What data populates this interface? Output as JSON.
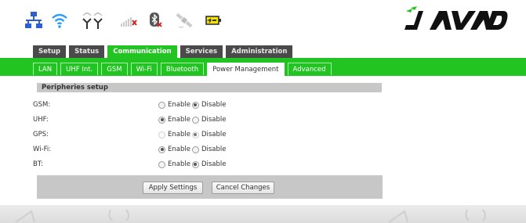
{
  "header": {
    "status_icons": [
      "lan-icon",
      "wifi-icon",
      "uhf-antennas-icon",
      "signal-bars-icon",
      "bluetooth-icon",
      "satellite-icon",
      "battery-icon"
    ],
    "logo_text": "JAVAD",
    "colors": {
      "accent_green": "#22c422",
      "dark_tab": "#4a4a4a",
      "battery_yellow": "#f5e400",
      "alert_red": "#d42020"
    }
  },
  "main_tabs": [
    {
      "label": "Setup",
      "active": false
    },
    {
      "label": "Status",
      "active": false
    },
    {
      "label": "Communication",
      "active": true
    },
    {
      "label": "Services",
      "active": false
    },
    {
      "label": "Administration",
      "active": false
    }
  ],
  "sub_tabs": [
    {
      "label": "LAN",
      "active": false
    },
    {
      "label": "UHF Int.",
      "active": false
    },
    {
      "label": "GSM",
      "active": false
    },
    {
      "label": "Wi-Fi",
      "active": false
    },
    {
      "label": "Bluetooth",
      "active": false
    },
    {
      "label": "Power Management",
      "active": true
    },
    {
      "label": "Advanced",
      "active": false
    }
  ],
  "section": {
    "title": "Peripheries setup",
    "enable_label": "Enable",
    "disable_label": "Disable",
    "rows": [
      {
        "label": "GSM:",
        "value": "Disable",
        "disabled": false
      },
      {
        "label": "UHF:",
        "value": "Enable",
        "disabled": false
      },
      {
        "label": "GPS:",
        "value": "Disable",
        "disabled": true
      },
      {
        "label": "Wi-Fi:",
        "value": "Enable",
        "disabled": false
      },
      {
        "label": "BT:",
        "value": "Disable",
        "disabled": false
      }
    ]
  },
  "actions": {
    "apply_label": "Apply Settings",
    "cancel_label": "Cancel Changes"
  }
}
